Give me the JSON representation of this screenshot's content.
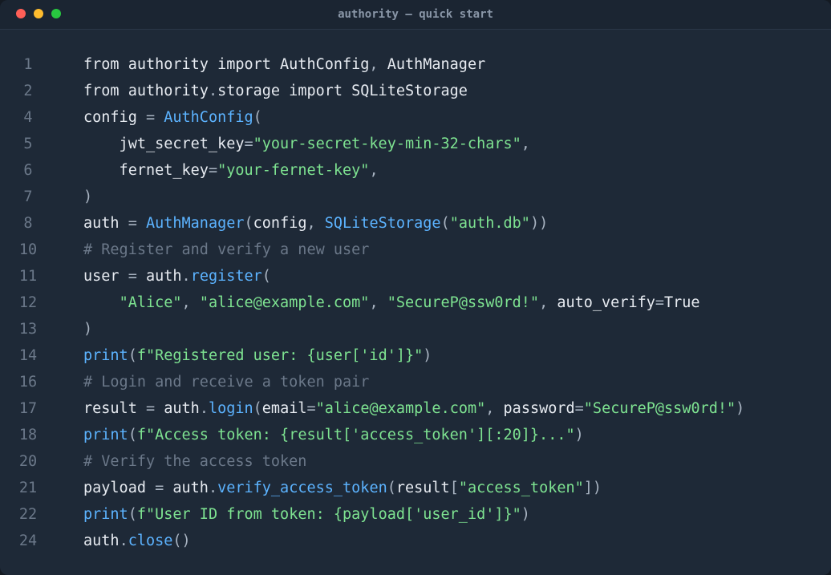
{
  "window": {
    "title": "authority — quick start"
  },
  "code": {
    "lines": [
      {
        "num": "1",
        "tokens": [
          {
            "t": "from authority import AuthConfig",
            "c": "plain"
          },
          {
            "t": ",",
            "c": "op"
          },
          {
            "t": " AuthManager",
            "c": "plain"
          }
        ]
      },
      {
        "num": "2",
        "tokens": [
          {
            "t": "from authority",
            "c": "plain"
          },
          {
            "t": ".",
            "c": "op"
          },
          {
            "t": "storage import SQLiteStorage",
            "c": "plain"
          }
        ]
      },
      {
        "num": "4",
        "tokens": [
          {
            "t": "config ",
            "c": "plain"
          },
          {
            "t": "=",
            "c": "op"
          },
          {
            "t": " ",
            "c": "plain"
          },
          {
            "t": "AuthConfig",
            "c": "fn"
          },
          {
            "t": "(",
            "c": "op"
          }
        ]
      },
      {
        "num": "5",
        "tokens": [
          {
            "t": "    jwt_secret_key",
            "c": "plain"
          },
          {
            "t": "=",
            "c": "op"
          },
          {
            "t": "\"your-secret-key-min-32-chars\"",
            "c": "str"
          },
          {
            "t": ",",
            "c": "op"
          }
        ]
      },
      {
        "num": "6",
        "tokens": [
          {
            "t": "    fernet_key",
            "c": "plain"
          },
          {
            "t": "=",
            "c": "op"
          },
          {
            "t": "\"your-fernet-key\"",
            "c": "str"
          },
          {
            "t": ",",
            "c": "op"
          }
        ]
      },
      {
        "num": "7",
        "tokens": [
          {
            "t": ")",
            "c": "op"
          }
        ]
      },
      {
        "num": "8",
        "tokens": [
          {
            "t": "auth ",
            "c": "plain"
          },
          {
            "t": "=",
            "c": "op"
          },
          {
            "t": " ",
            "c": "plain"
          },
          {
            "t": "AuthManager",
            "c": "fn"
          },
          {
            "t": "(",
            "c": "op"
          },
          {
            "t": "config",
            "c": "plain"
          },
          {
            "t": ",",
            "c": "op"
          },
          {
            "t": " ",
            "c": "plain"
          },
          {
            "t": "SQLiteStorage",
            "c": "fn"
          },
          {
            "t": "(",
            "c": "op"
          },
          {
            "t": "\"auth.db\"",
            "c": "str"
          },
          {
            "t": "))",
            "c": "op"
          }
        ]
      },
      {
        "num": "10",
        "tokens": [
          {
            "t": "# Register and verify a new user",
            "c": "cm"
          }
        ]
      },
      {
        "num": "11",
        "tokens": [
          {
            "t": "user ",
            "c": "plain"
          },
          {
            "t": "=",
            "c": "op"
          },
          {
            "t": " auth",
            "c": "plain"
          },
          {
            "t": ".",
            "c": "op"
          },
          {
            "t": "register",
            "c": "fn"
          },
          {
            "t": "(",
            "c": "op"
          }
        ]
      },
      {
        "num": "12",
        "tokens": [
          {
            "t": "    ",
            "c": "plain"
          },
          {
            "t": "\"Alice\"",
            "c": "str"
          },
          {
            "t": ",",
            "c": "op"
          },
          {
            "t": " ",
            "c": "plain"
          },
          {
            "t": "\"alice@example.com\"",
            "c": "str"
          },
          {
            "t": ",",
            "c": "op"
          },
          {
            "t": " ",
            "c": "plain"
          },
          {
            "t": "\"SecureP@ssw0rd!\"",
            "c": "str"
          },
          {
            "t": ",",
            "c": "op"
          },
          {
            "t": " auto_verify",
            "c": "plain"
          },
          {
            "t": "=",
            "c": "op"
          },
          {
            "t": "True",
            "c": "plain"
          }
        ]
      },
      {
        "num": "13",
        "tokens": [
          {
            "t": ")",
            "c": "op"
          }
        ]
      },
      {
        "num": "14",
        "tokens": [
          {
            "t": "print",
            "c": "fn"
          },
          {
            "t": "(",
            "c": "op"
          },
          {
            "t": "f\"Registered user: {user['id']}\"",
            "c": "str"
          },
          {
            "t": ")",
            "c": "op"
          }
        ]
      },
      {
        "num": "16",
        "tokens": [
          {
            "t": "# Login and receive a token pair",
            "c": "cm"
          }
        ]
      },
      {
        "num": "17",
        "tokens": [
          {
            "t": "result ",
            "c": "plain"
          },
          {
            "t": "=",
            "c": "op"
          },
          {
            "t": " auth",
            "c": "plain"
          },
          {
            "t": ".",
            "c": "op"
          },
          {
            "t": "login",
            "c": "fn"
          },
          {
            "t": "(",
            "c": "op"
          },
          {
            "t": "email",
            "c": "plain"
          },
          {
            "t": "=",
            "c": "op"
          },
          {
            "t": "\"alice@example.com\"",
            "c": "str"
          },
          {
            "t": ",",
            "c": "op"
          },
          {
            "t": " password",
            "c": "plain"
          },
          {
            "t": "=",
            "c": "op"
          },
          {
            "t": "\"SecureP@ssw0rd!\"",
            "c": "str"
          },
          {
            "t": ")",
            "c": "op"
          }
        ]
      },
      {
        "num": "18",
        "tokens": [
          {
            "t": "print",
            "c": "fn"
          },
          {
            "t": "(",
            "c": "op"
          },
          {
            "t": "f\"Access token: {result['access_token'][:20]}...\"",
            "c": "str"
          },
          {
            "t": ")",
            "c": "op"
          }
        ]
      },
      {
        "num": "20",
        "tokens": [
          {
            "t": "# Verify the access token",
            "c": "cm"
          }
        ]
      },
      {
        "num": "21",
        "tokens": [
          {
            "t": "payload ",
            "c": "plain"
          },
          {
            "t": "=",
            "c": "op"
          },
          {
            "t": " auth",
            "c": "plain"
          },
          {
            "t": ".",
            "c": "op"
          },
          {
            "t": "verify_access_token",
            "c": "fn"
          },
          {
            "t": "(",
            "c": "op"
          },
          {
            "t": "result",
            "c": "plain"
          },
          {
            "t": "[",
            "c": "op"
          },
          {
            "t": "\"access_token\"",
            "c": "str"
          },
          {
            "t": "])",
            "c": "op"
          }
        ]
      },
      {
        "num": "22",
        "tokens": [
          {
            "t": "print",
            "c": "fn"
          },
          {
            "t": "(",
            "c": "op"
          },
          {
            "t": "f\"User ID from token: {payload['user_id']}\"",
            "c": "str"
          },
          {
            "t": ")",
            "c": "op"
          }
        ]
      },
      {
        "num": "24",
        "tokens": [
          {
            "t": "auth",
            "c": "plain"
          },
          {
            "t": ".",
            "c": "op"
          },
          {
            "t": "close",
            "c": "fn"
          },
          {
            "t": "()",
            "c": "op"
          }
        ]
      }
    ]
  },
  "colors": {
    "background": "#1e2937",
    "function": "#5cb3ff",
    "string": "#7ee391",
    "comment": "#6b7889",
    "text": "#e7ebf1"
  }
}
